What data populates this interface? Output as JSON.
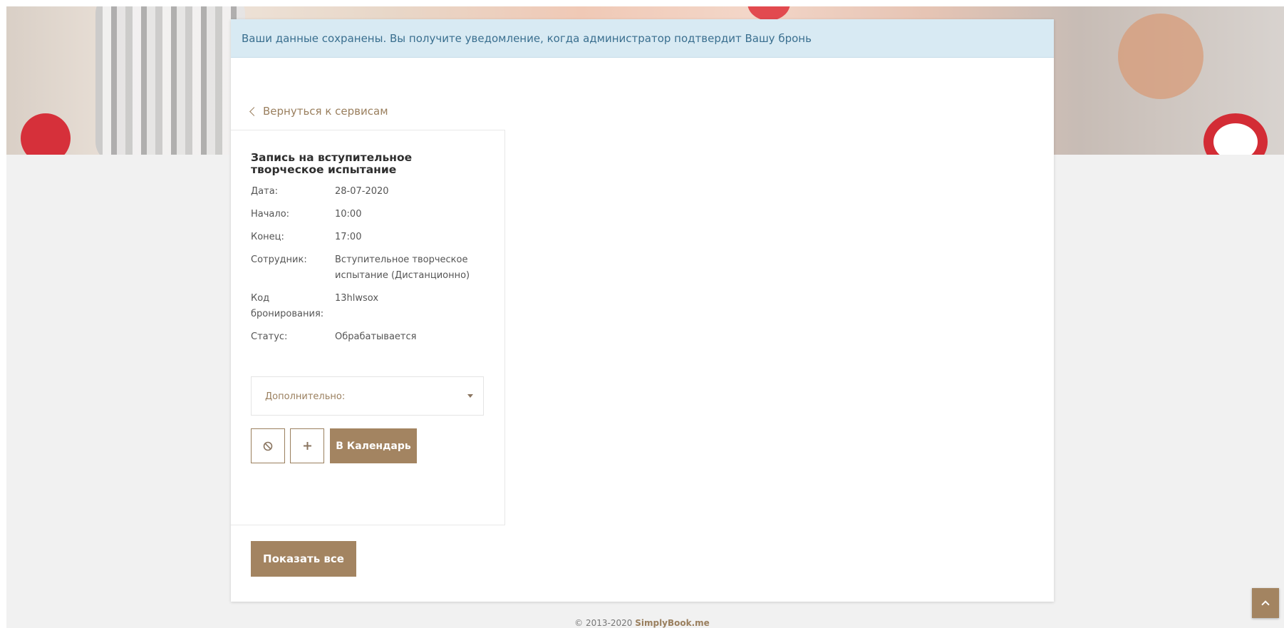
{
  "alert": {
    "message": "Ваши данные сохранены. Вы получите уведомление, когда администратор подтвердит Вашу бронь"
  },
  "nav": {
    "back_label": "Вернуться к сервисам"
  },
  "booking": {
    "title": "Запись на вступительное творческое испытание",
    "details": [
      {
        "label": "Дата:",
        "value": "28-07-2020"
      },
      {
        "label": "Начало:",
        "value": "10:00"
      },
      {
        "label": "Конец:",
        "value": "17:00"
      },
      {
        "label": "Сотрудник:",
        "value": "Вступительное творческое испытание (Дистанционно)"
      },
      {
        "label": "Код бронирования:",
        "value": "13hlwsox"
      },
      {
        "label": "Статус:",
        "value": "Обрабатывается"
      }
    ],
    "extra_label": "Дополнительно:",
    "calendar_button": "В Календарь",
    "icons": {
      "cancel": "cancel-circle-icon",
      "add": "plus-icon"
    }
  },
  "show_all_label": "Показать все",
  "footer": {
    "copyright": "© 2013-2020",
    "brand": "SimplyBook.me"
  },
  "colors": {
    "accent": "#a38461",
    "alert_bg": "#d8eaf3",
    "alert_text": "#3a6f8f"
  }
}
